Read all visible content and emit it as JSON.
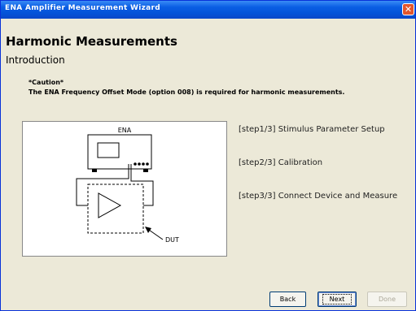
{
  "window": {
    "title": "ENA Amplifier Measurement Wizard"
  },
  "header": {
    "title": "Harmonic Measurements",
    "subtitle": "Introduction"
  },
  "caution": {
    "title": "*Caution*",
    "text": "The ENA Frequency Offset Mode (option 008) is required for harmonic measurements."
  },
  "diagram": {
    "instrument_label": "ENA",
    "dut_label": "DUT"
  },
  "steps": [
    {
      "label": "[step1/3] Stimulus Parameter Setup"
    },
    {
      "label": "[step2/3] Calibration"
    },
    {
      "label": "[step3/3] Connect Device and Measure"
    }
  ],
  "buttons": {
    "back": "Back",
    "next": "Next",
    "done": "Done"
  }
}
